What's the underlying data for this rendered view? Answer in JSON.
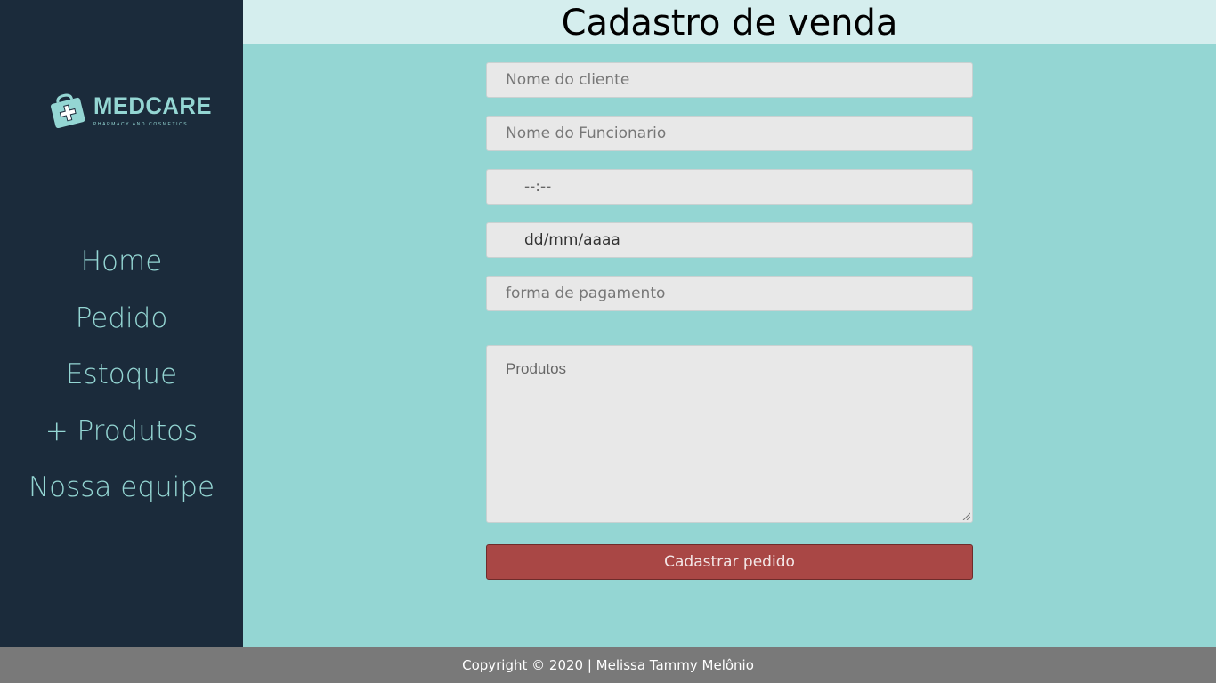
{
  "brand": {
    "name": "MEDCARE",
    "tagline": "PHARMACY AND COSMETICS",
    "color": "#94d6d3"
  },
  "sidebar": {
    "items": [
      {
        "label": "Home"
      },
      {
        "label": "Pedido"
      },
      {
        "label": "Estoque"
      },
      {
        "label": "+ Produtos"
      },
      {
        "label": "Nossa equipe"
      }
    ]
  },
  "header": {
    "title": "Cadastro de venda"
  },
  "form": {
    "cliente_placeholder": "Nome do cliente",
    "funcionario_placeholder": "Nome do Funcionario",
    "hora_value": "--:--",
    "data_value": "dd/mm/aaaa",
    "pagamento_placeholder": "forma de pagamento",
    "produtos_placeholder": "Produtos",
    "submit_label": "Cadastrar pedido"
  },
  "footer": {
    "text": "Copyright © 2020 | Melissa Tammy Melônio"
  },
  "colors": {
    "sidebar_bg": "#1b2b3b",
    "main_bg": "#94d6d3",
    "header_bg": "#d5eeee",
    "button_bg": "#a94745",
    "footer_bg": "#797979"
  }
}
